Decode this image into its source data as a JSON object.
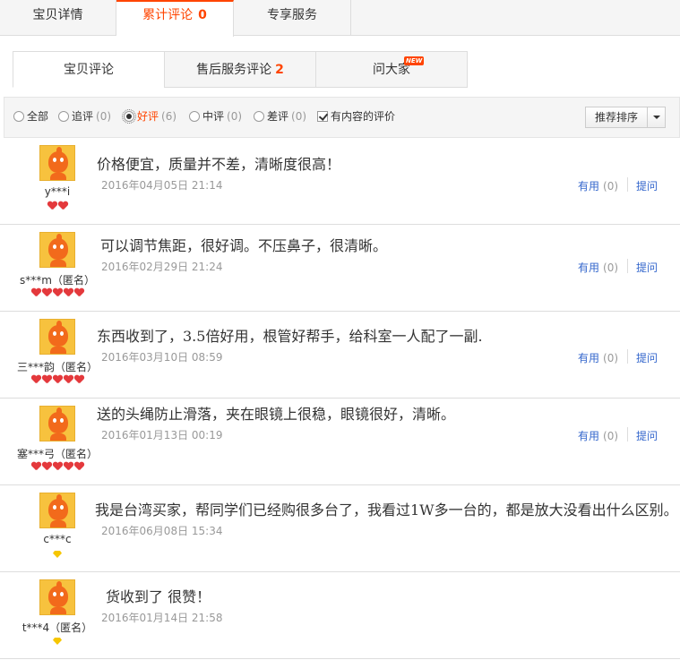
{
  "top_tabs": [
    {
      "label": "宝贝详情",
      "count": ""
    },
    {
      "label": "累计评论",
      "count": "0"
    },
    {
      "label": "专享服务",
      "count": ""
    }
  ],
  "sub_tabs": [
    {
      "label": "宝贝评论",
      "count": ""
    },
    {
      "label": "售后服务评论",
      "count": "2"
    },
    {
      "label": "问大家",
      "count": "",
      "badge": "NEW"
    }
  ],
  "filters": [
    {
      "label": "全部",
      "count": ""
    },
    {
      "label": "追评",
      "count": "(0)"
    },
    {
      "label": "好评",
      "count": "(6)",
      "selected": true
    },
    {
      "label": "中评",
      "count": "(0)"
    },
    {
      "label": "差评",
      "count": "(0)"
    }
  ],
  "content_only": {
    "label": "有内容的评价",
    "checked": true
  },
  "sort": {
    "label": "推荐排序"
  },
  "colors": {
    "accent": "#ff4400",
    "link": "#3366cc",
    "rank_red": "#e4393c",
    "rank_gold": "#f6c600"
  },
  "reviews": [
    {
      "user": "y***i",
      "rank": {
        "type": "heart",
        "count": 2
      },
      "content": "价格便宜，质量并不差，清晰度很高！",
      "date": "2016年04月05日 21:14",
      "useful_label": "有用",
      "useful_count": "(0)",
      "ask_label": "提问"
    },
    {
      "user": "s***m（匿名）",
      "rank": {
        "type": "heart",
        "count": 5
      },
      "content": "可以调节焦距，很好调。不压鼻子，很清晰。",
      "date": "2016年02月29日 21:24",
      "useful_label": "有用",
      "useful_count": "(0)",
      "ask_label": "提问"
    },
    {
      "user": "三***韵（匿名）",
      "rank": {
        "type": "heart",
        "count": 5
      },
      "content": "东西收到了，3.5倍好用，根管好帮手，给科室一人配了一副.",
      "date": "2016年03月10日 08:59",
      "useful_label": "有用",
      "useful_count": "(0)",
      "ask_label": "提问"
    },
    {
      "user": "塞***弓（匿名）",
      "rank": {
        "type": "heart",
        "count": 5
      },
      "content": "送的头绳防止滑落，夹在眼镜上很稳，眼镜很好，清晰。",
      "date": "2016年01月13日 00:19",
      "useful_label": "有用",
      "useful_count": "(0)",
      "ask_label": "提问"
    },
    {
      "user": "c***c",
      "rank": {
        "type": "diamond",
        "count": 1
      },
      "content": "我是台湾买家，帮同学们已经购很多台了，我看过1W多一台的，都是放大没看出什么区别。",
      "date": "2016年06月08日 15:34",
      "useful_label": "",
      "useful_count": "",
      "ask_label": ""
    },
    {
      "user": "t***4（匿名）",
      "rank": {
        "type": "diamond",
        "count": 1
      },
      "content": "货收到了 很赞！",
      "date": "2016年01月14日 21:58",
      "useful_label": "",
      "useful_count": "",
      "ask_label": ""
    }
  ]
}
